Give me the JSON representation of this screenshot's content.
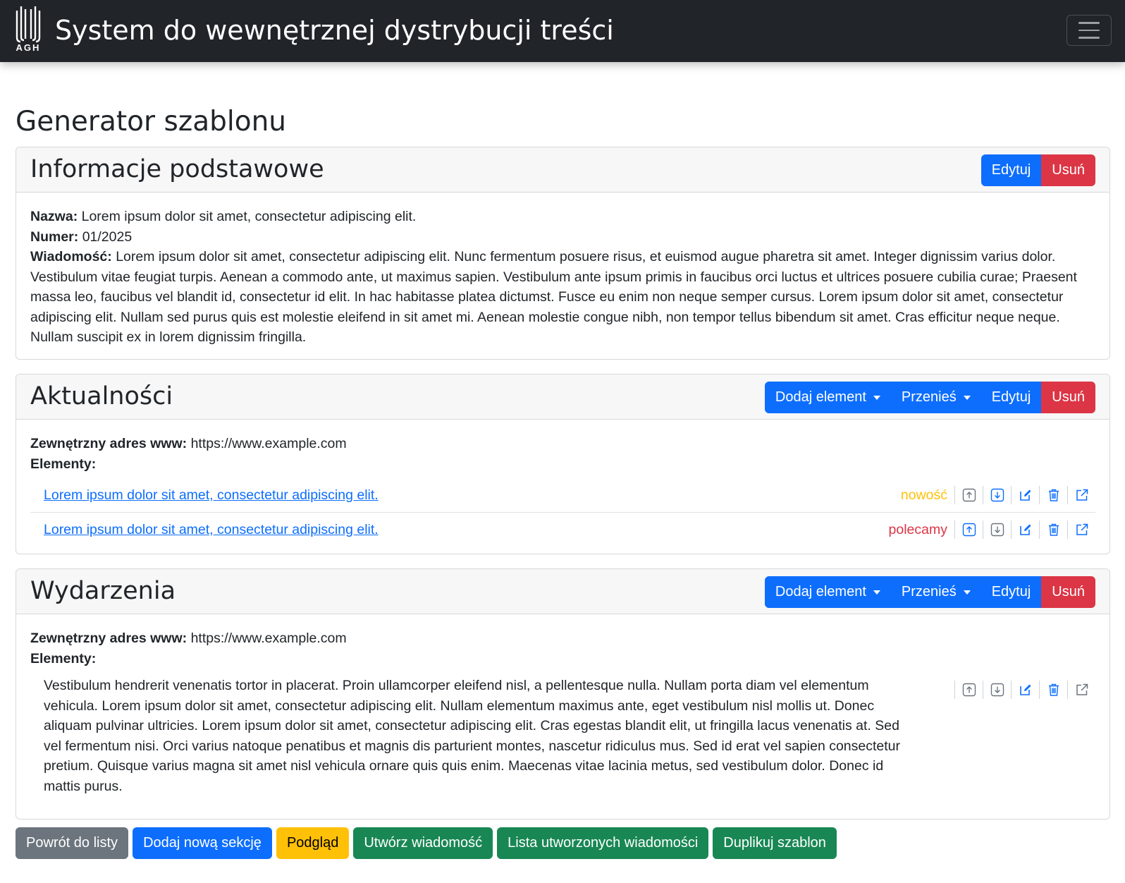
{
  "navbar": {
    "logo_text": "AGH",
    "title": "System do wewnętrznej dystrybucji treści"
  },
  "page_title": "Generator szablonu",
  "basic_info": {
    "title": "Informacje podstawowe",
    "edit_label": "Edytuj",
    "delete_label": "Usuń",
    "name_label": "Nazwa:",
    "name_value": "Lorem ipsum dolor sit amet, consectetur adipiscing elit.",
    "number_label": "Numer:",
    "number_value": "01/2025",
    "message_label": "Wiadomość:",
    "message_value": "Lorem ipsum dolor sit amet, consectetur adipiscing elit. Nunc fermentum posuere risus, et euismod augue pharetra sit amet. Integer dignissim varius dolor. Vestibulum vitae feugiat turpis. Aenean a commodo ante, ut maximus sapien. Vestibulum ante ipsum primis in faucibus orci luctus et ultrices posuere cubilia curae; Praesent massa leo, faucibus vel blandit id, consectetur id elit. In hac habitasse platea dictumst. Fusce eu enim non neque semper cursus. Lorem ipsum dolor sit amet, consectetur adipiscing elit. Nullam sed purus quis est molestie eleifend in sit amet mi. Aenean molestie congue nibh, non tempor tellus bibendum sit amet. Cras efficitur neque neque. Nullam suscipit ex in lorem dignissim fringilla."
  },
  "sections": [
    {
      "title": "Aktualności",
      "add_label": "Dodaj element",
      "move_label": "Przenieś",
      "edit_label": "Edytuj",
      "delete_label": "Usuń",
      "url_label": "Zewnętrzny adres www:",
      "url_value": "https://www.example.com",
      "elements_label": "Elementy:",
      "elements": [
        {
          "text": "Lorem ipsum dolor sit amet, consectetur adipiscing elit.",
          "tag": "nowość",
          "tag_color": "#ffc107"
        },
        {
          "text": "Lorem ipsum dolor sit amet, consectetur adipiscing elit.",
          "tag": "polecamy",
          "tag_color": "#dc3545"
        }
      ]
    },
    {
      "title": "Wydarzenia",
      "add_label": "Dodaj element",
      "move_label": "Przenieś",
      "edit_label": "Edytuj",
      "delete_label": "Usuń",
      "url_label": "Zewnętrzny adres www:",
      "url_value": "https://www.example.com",
      "elements_label": "Elementy:",
      "elements": [
        {
          "text": "Vestibulum hendrerit venenatis tortor in placerat. Proin ullamcorper eleifend nisl, a pellentesque nulla. Nullam porta diam vel elementum vehicula. Lorem ipsum dolor sit amet, consectetur adipiscing elit. Nullam elementum maximus ante, eget vestibulum nisl mollis ut. Donec aliquam pulvinar ultricies. Lorem ipsum dolor sit amet, consectetur adipiscing elit. Cras egestas blandit elit, ut fringilla lacus venenatis at. Sed vel fermentum nisi. Orci varius natoque penatibus et magnis dis parturient montes, nascetur ridiculus mus. Sed id erat vel sapien consectetur pretium. Quisque varius magna sit amet nisl vehicula ornare quis quis enim. Maecenas vitae lacinia metus, sed vestibulum dolor. Donec id mattis purus."
        }
      ]
    }
  ],
  "footer": {
    "back_label": "Powrót do listy",
    "add_section_label": "Dodaj nową sekcję",
    "preview_label": "Podgląd",
    "create_message_label": "Utwórz wiadomość",
    "message_list_label": "Lista utworzonych wiadomości",
    "duplicate_label": "Duplikuj szablon"
  },
  "colors": {
    "navbar": "#212529",
    "primary": "#0d6efd",
    "danger": "#dc3545",
    "secondary": "#6c757d",
    "warning": "#ffc107",
    "success": "#198754"
  },
  "icons": [
    "arrow-up-icon",
    "arrow-down-icon",
    "edit-icon",
    "trash-icon",
    "external-link-icon",
    "hamburger-icon"
  ]
}
